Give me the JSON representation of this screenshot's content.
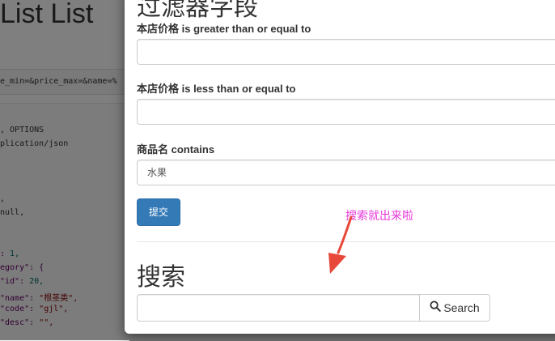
{
  "background": {
    "title": "List List",
    "url_fragment": "e_min=&price_max=&name=%",
    "code_lines": [
      {
        "pre": "",
        "tok": ", OPTIONS",
        "cls": ""
      },
      {
        "pre": "",
        "tok": "plication/json",
        "cls": ""
      },
      {
        "pre": "",
        "tok": "",
        "cls": ""
      },
      {
        "pre": "",
        "tok": "",
        "cls": ""
      },
      {
        "pre": "",
        "tok": "",
        "cls": ""
      },
      {
        "pre": "",
        "tok": ",",
        "cls": ""
      },
      {
        "pre": "",
        "tok": "null,",
        "cls": ""
      },
      {
        "pre": "",
        "tok": "",
        "cls": ""
      },
      {
        "pre": "",
        "tok": "",
        "cls": ""
      },
      {
        "pre": ": ",
        "tok": "1,",
        "cls": "num"
      },
      {
        "pre": "",
        "tok": "egory\": {",
        "cls": "key"
      },
      {
        "pre": "\"id\": ",
        "tok": "20,",
        "cls": "num"
      },
      {
        "pre": "\"name\": ",
        "tok": "\"根茎类\",",
        "cls": "str"
      },
      {
        "pre": "\"code\": ",
        "tok": "\"gjl\",",
        "cls": "str"
      },
      {
        "pre": "\"desc\": ",
        "tok": "\"\",",
        "cls": "str"
      }
    ]
  },
  "modal": {
    "heading": "过滤器字段",
    "fields": [
      {
        "label": "本店价格 is greater than or equal to",
        "value": ""
      },
      {
        "label": "本店价格 is less than or equal to",
        "value": ""
      },
      {
        "label": "商品名 contains",
        "value": "水果"
      }
    ],
    "submit_label": "提交",
    "search_heading": "搜索",
    "search_value": "",
    "search_button_label": "Search",
    "search_icon": "magnifier-icon"
  },
  "annotation": {
    "text": "搜索就出来啦",
    "color": "#e83ad8"
  },
  "colors": {
    "primary": "#337ab7",
    "overlay": "rgba(0,0,0,0.5)"
  }
}
